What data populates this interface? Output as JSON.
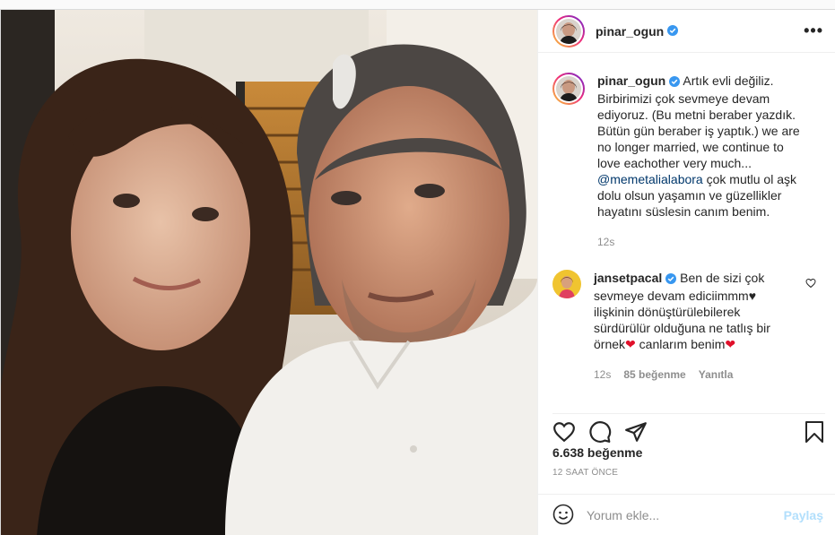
{
  "post": {
    "username": "pinar_ogun",
    "verified": true,
    "more_label": "•••"
  },
  "caption": {
    "username": "pinar_ogun",
    "text_before": "Artık evli değiliz. Birbirimizi çok sevmeye devam ediyoruz. (Bu metni beraber yazdık. Bütün gün beraber iş yaptık.) we are no longer married, we continue to love eachother very much...",
    "mention": "@memetalialabora",
    "text_after": "çok mutlu ol aşk dolu olsun yaşamın ve güzellikler hayatını süslesin canım benim.",
    "time": "12s"
  },
  "comment": {
    "username": "jansetpacal",
    "text1": "Ben de sizi çok sevmeye devam ediciimmm",
    "heart1": "♥",
    "text2": "ilişkinin dönüştürülebilerek sürdürülür olduğuna ne tatlış bir örnek",
    "heart2": "❤",
    "text3": "canlarım benim",
    "heart3": "❤",
    "time": "12s",
    "likes": "85 beğenme",
    "reply": "Yanıtla"
  },
  "likes_count": "6.638 beğenme",
  "timestamp": "12 SAAT ÖNCE",
  "add_comment": {
    "placeholder": "Yorum ekle...",
    "post_label": "Paylaş"
  },
  "icons": {
    "like": "heart-icon",
    "comment": "comment-icon",
    "share": "share-icon",
    "save": "bookmark-icon",
    "emoji": "emoji-icon",
    "verified": "verified-badge-icon"
  },
  "colors": {
    "link": "#00376b",
    "verified": "#3897f0",
    "post_disabled": "#b2dffc",
    "heart_red": "#e0102a",
    "muted": "#8e8e8e"
  }
}
